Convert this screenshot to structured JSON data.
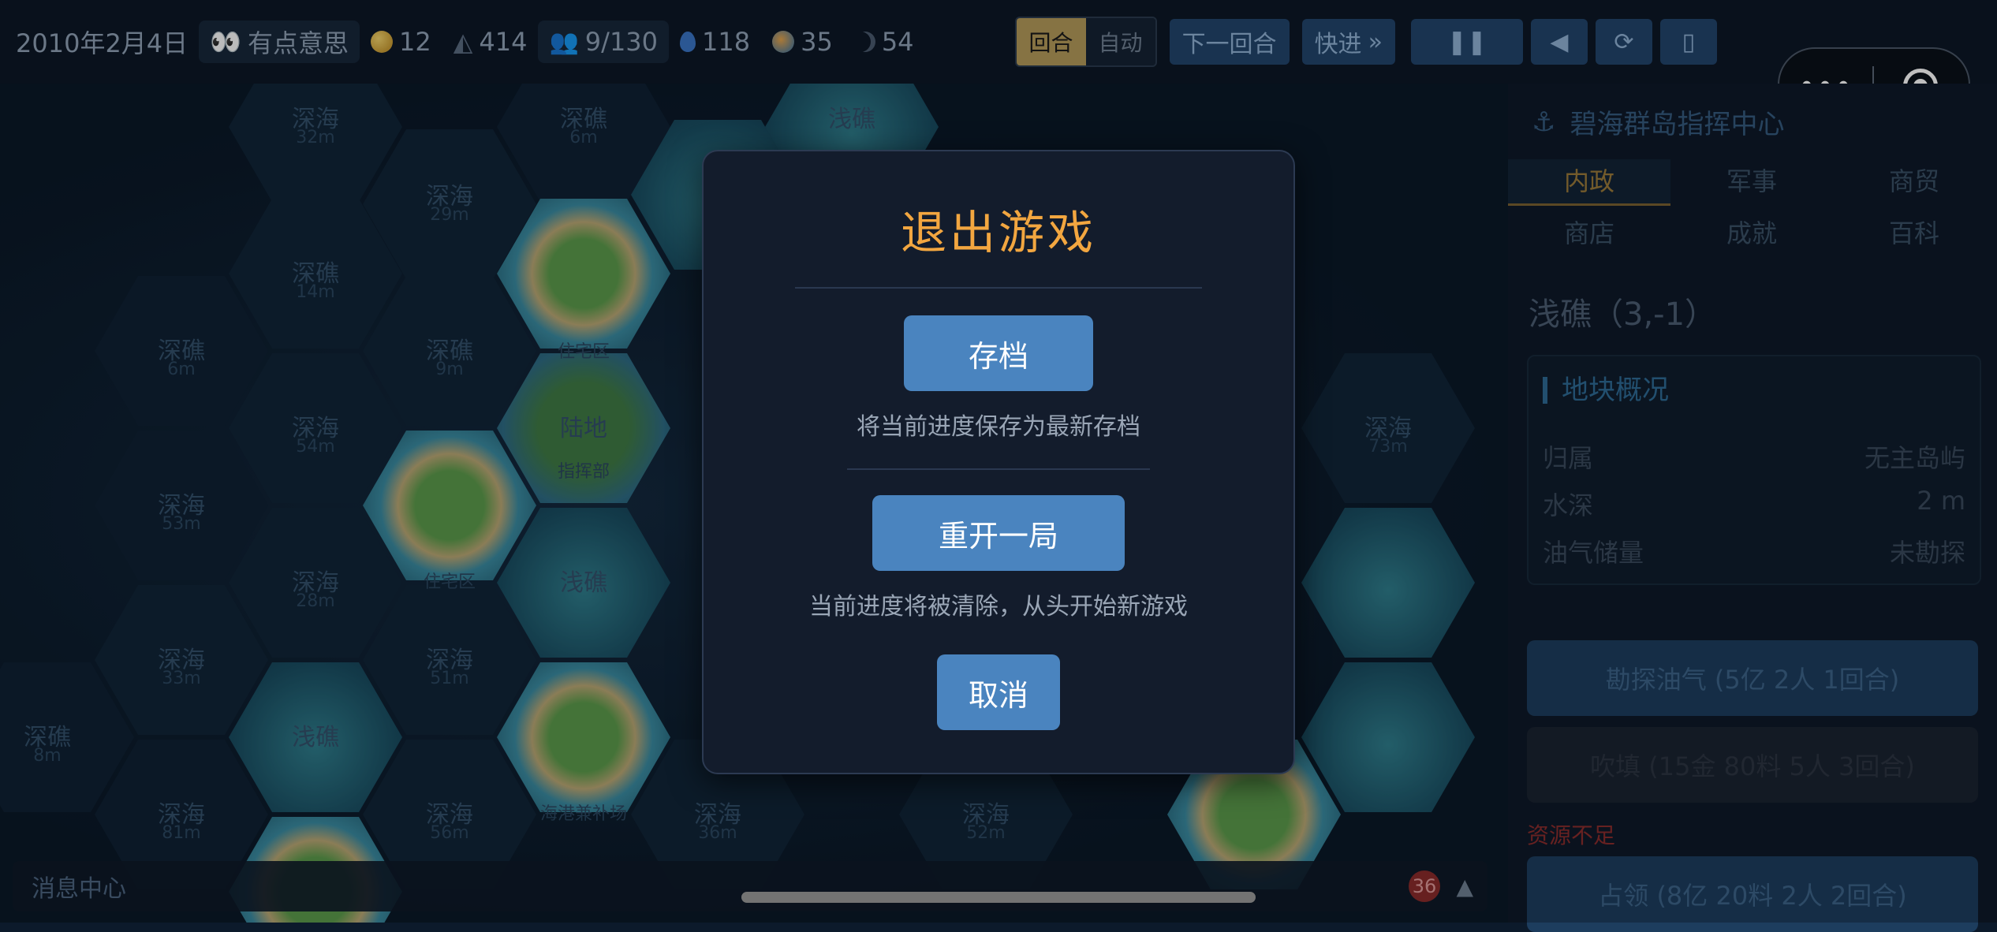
{
  "topbar": {
    "date": "2010年2月4日",
    "mood": "有点意思",
    "gold": "12",
    "material": "414",
    "population": "9/130",
    "water": "118",
    "globe": "35",
    "moon": "54",
    "mode_turn": "回合",
    "mode_auto": "自动",
    "next_turn": "下一回合",
    "fast_forward": "快进"
  },
  "map": {
    "tiles": [
      {
        "label": "深海",
        "sub": "32m"
      },
      {
        "label": "深礁",
        "sub": "6m"
      },
      {
        "label": "浅礁",
        "sub": ""
      },
      {
        "label": "深海",
        "sub": "29m"
      },
      {
        "label": "深礁",
        "sub": "14m"
      },
      {
        "label": "深礁",
        "sub": "6m"
      },
      {
        "label": "深礁",
        "sub": "9m"
      },
      {
        "label": "住宅区",
        "sub": ""
      },
      {
        "label": "深海",
        "sub": "54m"
      },
      {
        "label": "陆地",
        "sub": "指挥部"
      },
      {
        "label": "深海",
        "sub": "73m"
      },
      {
        "label": "深海",
        "sub": "53m"
      },
      {
        "label": "深海",
        "sub": "28m"
      },
      {
        "label": "住宅区",
        "sub": ""
      },
      {
        "label": "浅礁",
        "sub": ""
      },
      {
        "label": "深海",
        "sub": "33m"
      },
      {
        "label": "深海",
        "sub": "51m"
      },
      {
        "label": "深礁",
        "sub": "8m"
      },
      {
        "label": "浅礁",
        "sub": ""
      },
      {
        "label": "深海",
        "sub": "81m"
      },
      {
        "label": "深海",
        "sub": "56m"
      },
      {
        "label": "海港兼补场",
        "sub": ""
      },
      {
        "label": "深海",
        "sub": "36m"
      },
      {
        "label": "深海",
        "sub": "52m"
      }
    ]
  },
  "message_center": {
    "title": "消息中心",
    "count": "36"
  },
  "panel": {
    "title": "碧海群岛指挥中心",
    "tabs": [
      "内政",
      "军事",
      "商贸",
      "商店",
      "成就",
      "百科"
    ],
    "tile_title": "浅礁（3,-1）",
    "overview_title": "地块概况",
    "rows": [
      {
        "key": "归属",
        "value": "无主岛屿"
      },
      {
        "key": "水深",
        "value": "2 m"
      },
      {
        "key": "油气储量",
        "value": "未勘探"
      }
    ],
    "actions": {
      "explore": "勘探油气 (5亿 2人 1回合)",
      "reclaim": "吹填 (15金 80料 5人 3回合)",
      "occupy": "占领 (8亿 20料 2人 2回合)"
    },
    "insufficient": "资源不足"
  },
  "modal": {
    "title": "退出游戏",
    "save_label": "存档",
    "save_desc": "将当前进度保存为最新存档",
    "restart_label": "重开一局",
    "restart_desc": "当前进度将被清除，从头开始新游戏",
    "cancel_label": "取消"
  },
  "colors": {
    "accent": "#f2a640",
    "button": "#4a84bf",
    "modal_bg": "#131c2c"
  }
}
